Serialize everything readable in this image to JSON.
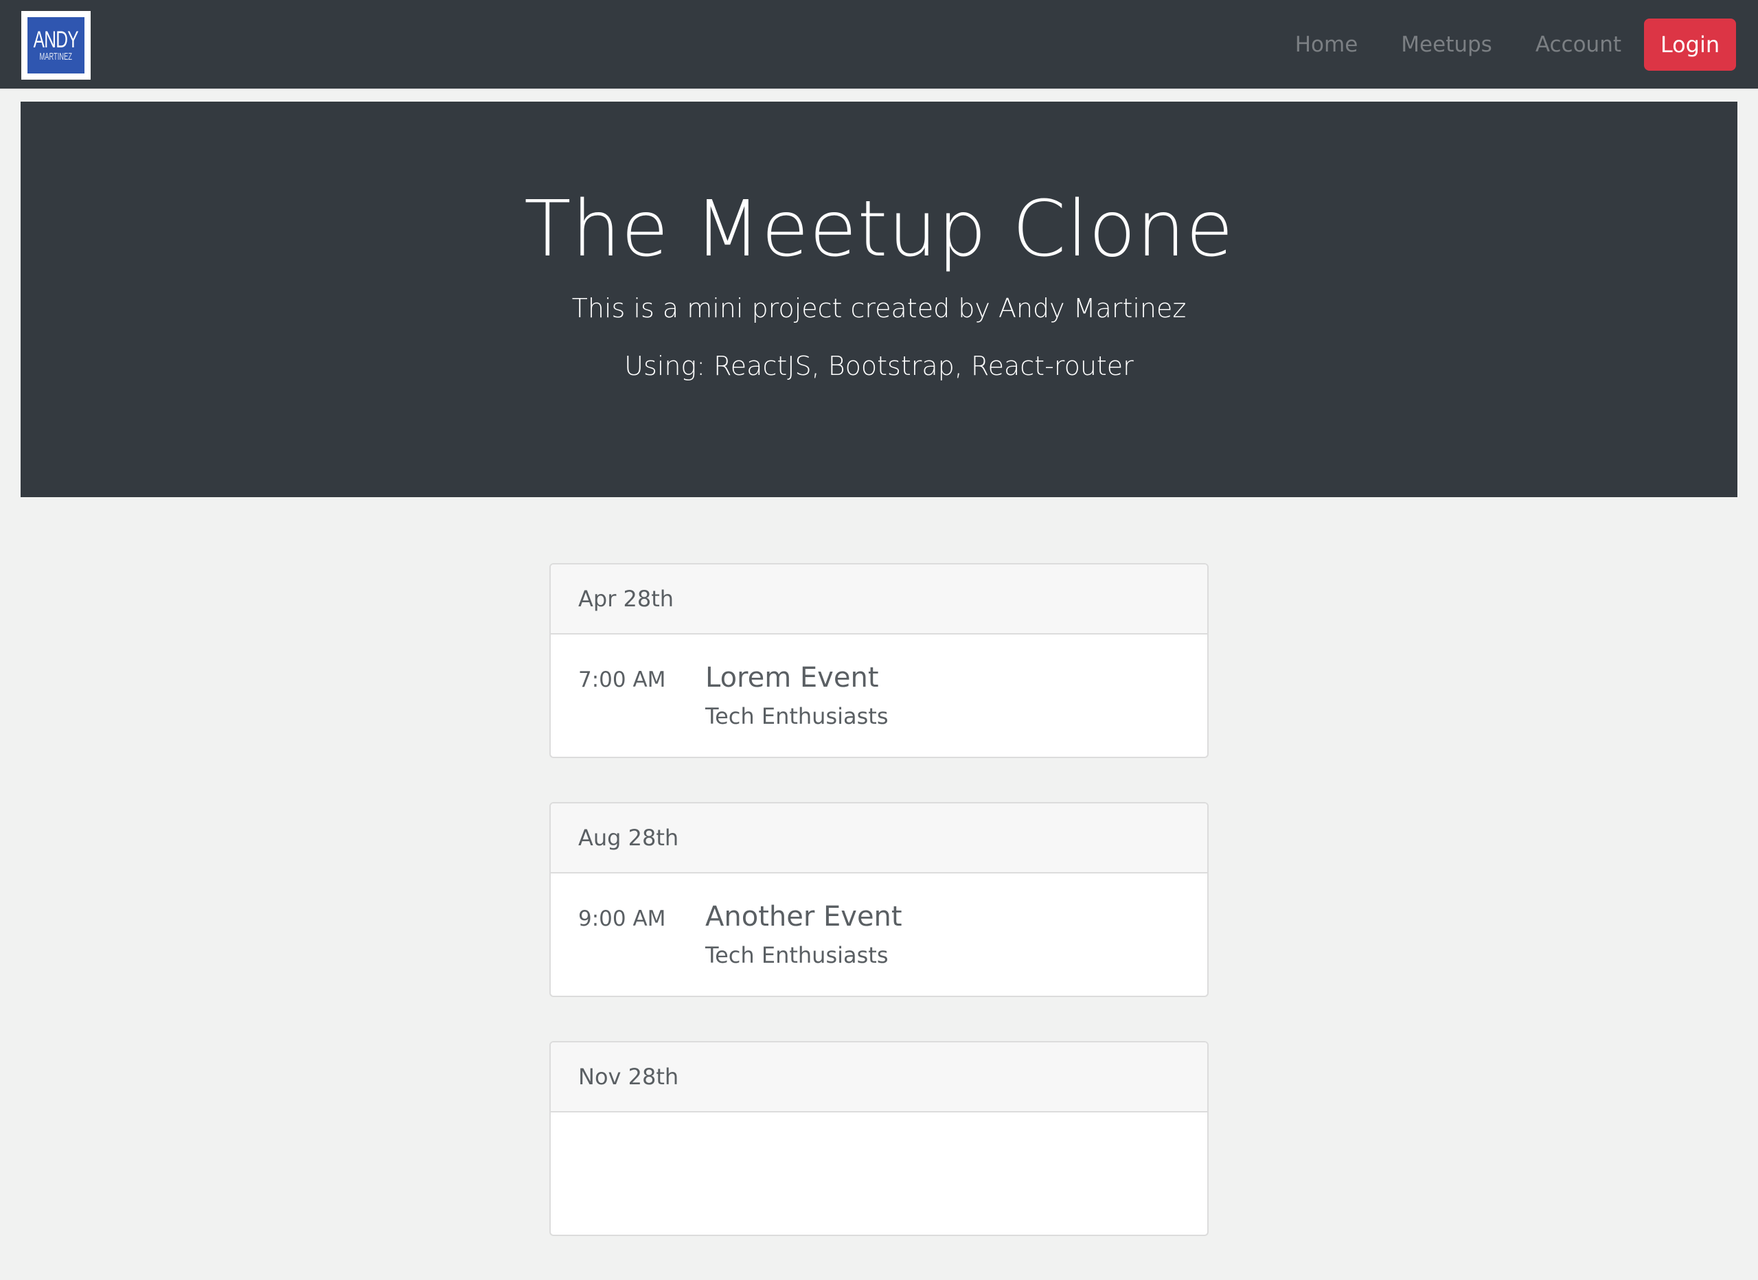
{
  "navbar": {
    "logo": {
      "top": "ANDY",
      "bottom": "MARTINEZ"
    },
    "links": [
      "Home",
      "Meetups",
      "Account"
    ],
    "login_label": "Login"
  },
  "hero": {
    "title": "The Meetup Clone",
    "subtitle": "This is a mini project created by Andy Martinez",
    "tech": "Using: ReactJS, Bootstrap, React-router"
  },
  "events": [
    {
      "date": "Apr 28th",
      "time": "7:00 AM",
      "title": "Lorem Event",
      "group": "Tech Enthusiasts"
    },
    {
      "date": "Aug 28th",
      "time": "9:00 AM",
      "title": "Another Event",
      "group": "Tech Enthusiasts"
    },
    {
      "date": "Nov 28th"
    }
  ],
  "colors": {
    "navbar_bg": "#343a40",
    "login_bg": "#dc3545",
    "logo_bg": "#2f56b0",
    "page_bg": "#f1f2f1"
  }
}
